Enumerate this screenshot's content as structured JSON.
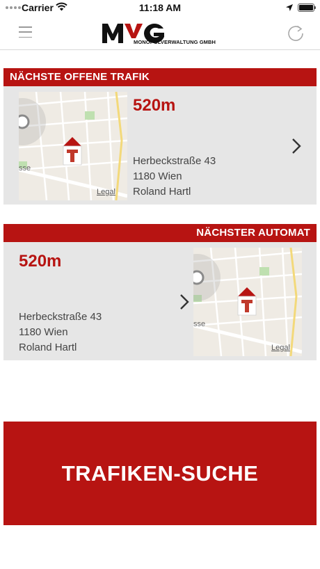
{
  "status_bar": {
    "carrier": "Carrier",
    "time": "11:18 AM",
    "icons": [
      "signal-dots-icon",
      "wifi-icon",
      "location-arrow-icon",
      "battery-icon"
    ]
  },
  "nav": {
    "menu_icon": "hamburger-menu-icon",
    "logo_mark": "MVG",
    "logo_subtitle": "MONOPOLVERWALTUNG GMBH",
    "refresh_icon": "refresh-icon"
  },
  "nearest_trafik": {
    "header": "NÄCHSTE OFFENE TRAFIK",
    "distance": "520m",
    "address_line1": "Herbeckstraße 43",
    "address_line2": "1180 Wien",
    "owner": "Roland Hartl",
    "map_street_fragment": "sse",
    "map_legal": "Legal"
  },
  "nearest_automat": {
    "header": "NÄCHSTER AUTOMAT",
    "distance": "520m",
    "address_line1": "Herbeckstraße 43",
    "address_line2": "1180 Wien",
    "owner": "Roland Hartl",
    "map_street_fragment": "sse",
    "map_legal": "Legal"
  },
  "search_button": {
    "label": "TRAFIKEN-SUCHE"
  },
  "colors": {
    "brand_red": "#b71412",
    "card_bg": "#e6e6e6",
    "text_gray": "#444444"
  }
}
